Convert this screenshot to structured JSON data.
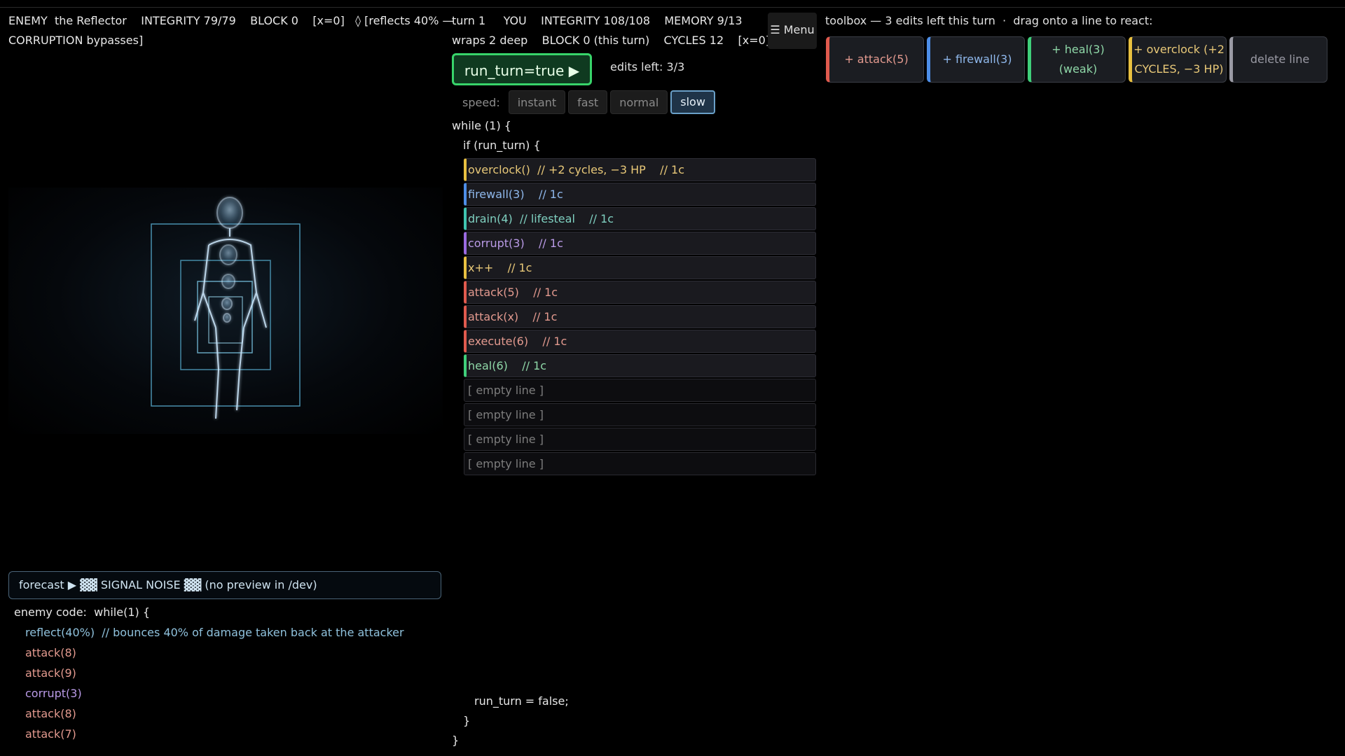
{
  "enemy": {
    "name": "ENEMY  the Reflector",
    "integrity": "INTEGRITY 79/79",
    "block": "BLOCK 0",
    "x": "[x=0]",
    "status_line1": "◊ [reflects 40% —",
    "status_line2": "CORRUPTION bypasses]",
    "forecast": "forecast ▶  ▓▓ SIGNAL NOISE ▓▓ (no preview in /dev)",
    "code_header": "enemy code:  while(1) {",
    "code": [
      {
        "text": "reflect(40%)  // bounces 40% of damage taken back at the attacker",
        "color": "cyan"
      },
      {
        "text": "attack(8)",
        "color": "red"
      },
      {
        "text": "attack(9)",
        "color": "red"
      },
      {
        "text": "corrupt(3)",
        "color": "purple"
      },
      {
        "text": "attack(8)",
        "color": "red"
      },
      {
        "text": "attack(7)",
        "color": "red"
      }
    ]
  },
  "player": {
    "turn": "turn 1",
    "label": "YOU",
    "integrity": "INTEGRITY 108/108",
    "memory": "MEMORY 9/13",
    "wraps": "wraps 2 deep",
    "block": "BLOCK 0 (this turn)",
    "cycles": "CYCLES 12",
    "x": "[x=0]"
  },
  "menu_label": "☰ Menu",
  "run_button": "run_turn=true  ▶",
  "edits_left": "edits left: 3/3",
  "speed": {
    "label": "speed:",
    "options": [
      "instant",
      "fast",
      "normal",
      "slow"
    ],
    "selected": "slow"
  },
  "code": {
    "while_open": "while (1) {",
    "if_open": "if (run_turn) {",
    "lines": [
      {
        "text": "overclock()  // +2 cycles, −3 HP    // 1c",
        "color": "yellow",
        "empty": false
      },
      {
        "text": "firewall(3)    // 1c",
        "color": "blue",
        "empty": false
      },
      {
        "text": "drain(4)  // lifesteal    // 1c",
        "color": "teal",
        "empty": false
      },
      {
        "text": "corrupt(3)    // 1c",
        "color": "purple",
        "empty": false
      },
      {
        "text": "x++    // 1c",
        "color": "yellow",
        "empty": false
      },
      {
        "text": "attack(5)    // 1c",
        "color": "red",
        "empty": false
      },
      {
        "text": "attack(x)    // 1c",
        "color": "red",
        "empty": false
      },
      {
        "text": "execute(6)    // 1c",
        "color": "red",
        "empty": false
      },
      {
        "text": "heal(6)    // 1c",
        "color": "green",
        "empty": false
      },
      {
        "text": "[ empty line ]",
        "color": "gray",
        "empty": true
      },
      {
        "text": "[ empty line ]",
        "color": "gray",
        "empty": true
      },
      {
        "text": "[ empty line ]",
        "color": "gray",
        "empty": true
      },
      {
        "text": "[ empty line ]",
        "color": "gray",
        "empty": true
      }
    ],
    "run_false": "run_turn = false;",
    "if_close": "}",
    "while_close": "}"
  },
  "toolbox": {
    "title": "toolbox — 3 edits left this turn  ·  drag onto a line to react:",
    "items": [
      {
        "label": "+ attack(5)",
        "color": "red"
      },
      {
        "label": "+ firewall(3)",
        "color": "blue"
      },
      {
        "label": "+ heal(3) (weak)",
        "color": "green"
      },
      {
        "label": "+ overclock (+2 CYCLES, −3 HP)",
        "color": "yellow"
      },
      {
        "label": "delete line",
        "color": "gray"
      }
    ]
  },
  "colors": {
    "red": "#e05a4e",
    "blue": "#4d8ee8",
    "green": "#3fcf7a",
    "yellow": "#e8c040",
    "teal": "#3fc4b0",
    "purple": "#9a6ae0",
    "gray": "#9a9aa4",
    "cyan": "#8fc1dc",
    "text_red": "#e39a8f",
    "text_blue": "#8fb8ec",
    "text_green": "#8fd8a8",
    "text_yellow": "#e8c878",
    "text_teal": "#7fd0c0",
    "text_purple": "#b99ae6",
    "text_gray": "#9a9aa4",
    "text_cyan": "#8fc1dc",
    "run_button": "#38d46a"
  }
}
